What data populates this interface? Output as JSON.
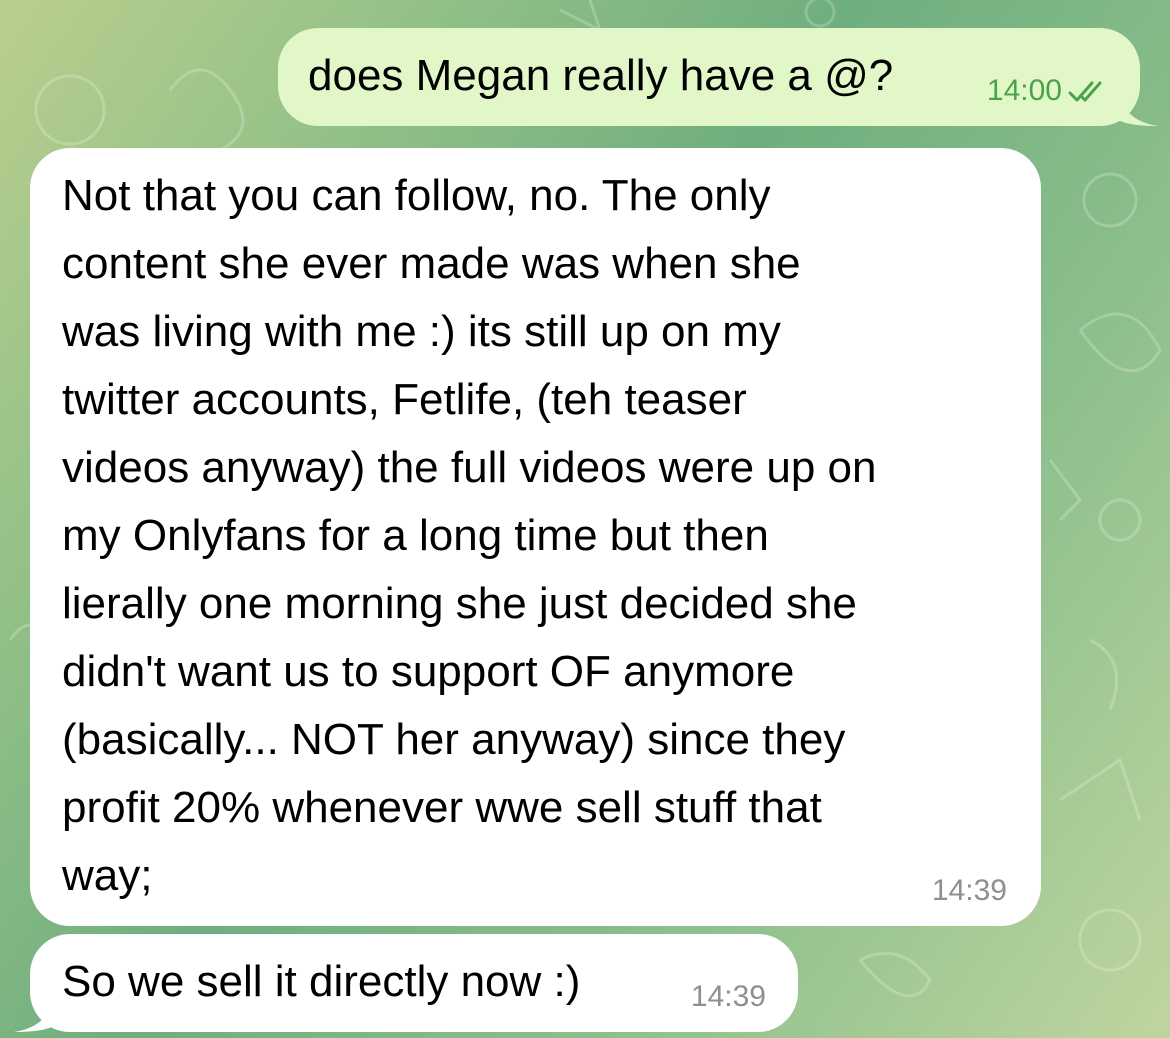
{
  "chat": {
    "messages": [
      {
        "direction": "outgoing",
        "text": "does Megan really have a @?",
        "time": "14:00",
        "status_icon": "double-check-icon",
        "bubble_color": "#e1f7c8",
        "time_color": "#4aa34a"
      },
      {
        "direction": "incoming",
        "text": "Not that you can follow, no. The only\ncontent she ever made was when she\nwas living with me :) its still up on my\ntwitter accounts, Fetlife, (teh teaser\nvideos anyway) the full videos were up on\nmy Onlyfans for a long time but then\nlierally one morning she just decided she\ndidn't want us to support OF anymore\n(basically... NOT her anyway) since they\nprofit 20% whenever wwe sell stuff that\nway;",
        "time": "14:39",
        "bubble_color": "#ffffff",
        "time_color": "#8e8e93"
      },
      {
        "direction": "incoming",
        "text": "So we sell it directly now :)",
        "time": "14:39",
        "bubble_color": "#ffffff",
        "time_color": "#8e8e93"
      }
    ]
  }
}
